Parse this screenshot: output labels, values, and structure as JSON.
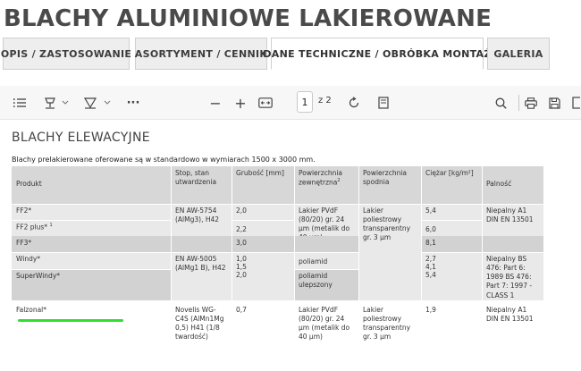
{
  "page": {
    "title": "BLACHY ALUMINIOWE LAKIEROWANE"
  },
  "tabs": [
    {
      "label": "OPIS / ZASTOSOWANIE"
    },
    {
      "label": "ASORTYMENT / CENNIK"
    },
    {
      "label": "DANE TECHNICZNE / OBRÓBKA MONTAŻ"
    },
    {
      "label": "GALERIA"
    }
  ],
  "toolbar": {
    "zoom_out": "−",
    "zoom_in": "+",
    "page_number": "1",
    "page_total": "z 2",
    "more": "···"
  },
  "doc": {
    "heading": "BLACHY ELEWACYJNE",
    "subtitle": "Blachy prelakierowane oferowane są w standardowo w wymiarach 1500 x 3000 mm.",
    "table": {
      "headers": {
        "produkt": "Produkt",
        "stop": "Stop, stan utwardzenia",
        "grubosc": "Grubość [mm]",
        "pow_zew": "Powierzchnia zewnętrzna",
        "pow_zew_sup": "2",
        "pow_spod": "Powierzchnia spodnia",
        "ciezar": "Ciężar [kg/m²]",
        "palnosc": "Palność"
      },
      "rows": {
        "ff2": "FF2*",
        "ff2plus": "FF2 plus*",
        "ff2plus_sup": "1",
        "ff3": "FF3*",
        "windy": "Windy*",
        "superwindy": "SuperWindy*",
        "falzonal": "Falzonal*"
      },
      "cells": {
        "ff_stop": "EN AW-5754 (AlMg3), H42",
        "ff2_gr": "2,0",
        "ff2plus_gr": "2,2",
        "ff3_gr": "3,0",
        "ff_pow_zew": "Lakier PVdF (80/20) gr. 24 µm (metalik do 40 µm)",
        "ff_pow_spod": "Lakier poliestrowy transparentny gr. 3 µm",
        "ff2_c": "5,4",
        "ff2plus_c": "6,0",
        "ff3_c": "8,1",
        "ff_pal": "Niepalny A1 DIN EN 13501",
        "windy_stop": "EN AW-5005 (AlMg1 B), H42",
        "windy_gr": "1,0\n1,5\n2,0",
        "windy_pow": "poliamid",
        "superwindy_pow": "poliamid ulepszony",
        "windy_c": "2,7\n4,1\n5,4",
        "windy_pal": "Niepalny BS 476: Part 6: 1989 BS 476: Part 7: 1997 - CLASS 1",
        "falz_stop": "Novelis WG-C4S (AlMn1Mg 0,5) H41 (1/8 twardość)",
        "falz_gr": "0,7",
        "falz_pow_zew": "Lakier PVdF (80/20) gr. 24 µm (metalik do 40 µm)",
        "falz_pow_spod": "Lakier poliestrowy transparentny gr. 3 µm",
        "falz_c": "1,9",
        "falz_pal": "Niepalny A1 DIN EN 13501"
      }
    }
  }
}
